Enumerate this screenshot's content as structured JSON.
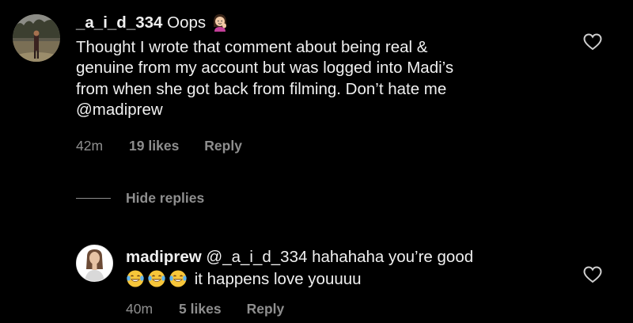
{
  "comments": [
    {
      "username": "_a_i_d_334",
      "text_inline": "Oops",
      "lines": [
        "Thought I wrote that comment about being real &",
        "genuine from my account but was logged into Madi’s",
        "from when she got back from filming. Don’t hate me",
        "@madiprew"
      ],
      "time": "42m",
      "likes": "19 likes",
      "reply_label": "Reply",
      "emoji": "woman-tipping-hand-icon"
    }
  ],
  "thread": {
    "hide_replies_label": "Hide replies"
  },
  "replies": [
    {
      "username": "madiprew",
      "mention": "@_a_i_d_334",
      "text_first": "hahahaha you’re good",
      "emojis": [
        "laughing-tears-icon",
        "laughing-tears-icon",
        "laughing-tears-icon"
      ],
      "text_second": "it happens love youuuu",
      "time": "40m",
      "likes": "5 likes",
      "reply_label": "Reply"
    }
  ],
  "colors": {
    "background": "#000000",
    "text": "#f0f0f0",
    "muted": "#8e8e8e",
    "heart": "#cfcfcf"
  }
}
